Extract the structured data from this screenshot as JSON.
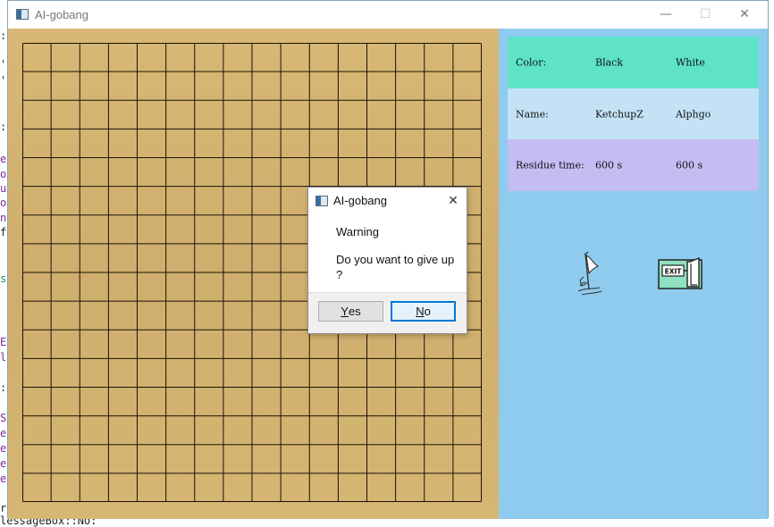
{
  "window": {
    "title": "AI-gobang",
    "minimize_symbol": "—",
    "maximize_symbol": "☐",
    "close_symbol": "✕"
  },
  "background_code": {
    "fragments": [
      ":",
      "'",
      "'",
      ":",
      "es",
      "or",
      "ul",
      "oa",
      "ne",
      "f(",
      "s",
      "E",
      "la",
      ":",
      "So",
      "et",
      "et",
      "et",
      "et",
      "re",
      "lessageBox::No:"
    ]
  },
  "board": {
    "rows": 16,
    "cols": 16
  },
  "info_panel": {
    "color_row": {
      "label": "Color:",
      "black": "Black",
      "white": "White"
    },
    "name_row": {
      "label": "Name:",
      "black": "KetchupZ",
      "white": "Alphgo"
    },
    "time_row": {
      "label": "Residue time:",
      "black": "600 s",
      "white": "600 s"
    }
  },
  "icons": {
    "give_up": "white-flag-icon",
    "exit": "exit-door-icon",
    "exit_label": "EXIT"
  },
  "dialog": {
    "title": "AI-gobang",
    "close_symbol": "✕",
    "heading": "Warning",
    "message": "Do you want to give up ?",
    "yes_accel": "Y",
    "yes_rest": "es",
    "no_accel": "N",
    "no_rest": "o"
  },
  "colors": {
    "board": "#d6b672",
    "panel": "#8ecbee",
    "color_row": "#5ee3c9",
    "name_row": "#c3e2f5",
    "time_row": "#c3bdf2",
    "default_button_border": "#0078d7"
  }
}
